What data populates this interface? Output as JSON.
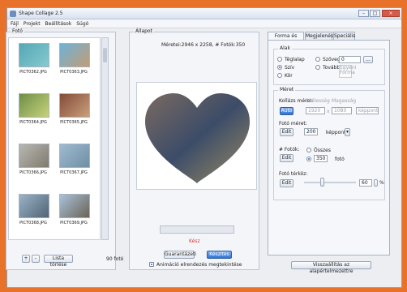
{
  "window": {
    "title": "Shape Collage 2.5"
  },
  "menu": [
    "Fájl",
    "Projekt",
    "Beállítások",
    "Súgó"
  ],
  "photo_panel": {
    "title": "Fotó",
    "thumbs": [
      {
        "label": "PICT0362.JPG"
      },
      {
        "label": "PICT0363.JPG"
      },
      {
        "label": "PICT0364.JPG"
      },
      {
        "label": "PICT0365.JPG"
      },
      {
        "label": "PICT0366.JPG"
      },
      {
        "label": "PICT0367.JPG"
      },
      {
        "label": "PICT0368.JPG"
      },
      {
        "label": "PICT0369.JPG"
      }
    ],
    "add_label": "+",
    "remove_label": "-",
    "clear_label": "Lista törlése",
    "count_label": "90 fotó"
  },
  "state_panel": {
    "title": "Állapot",
    "info": "Méretei:2946 x 2258, # Fotók:350",
    "status": "Kész",
    "save_label": "Guarantázeti",
    "create_label": "Készítés",
    "option_label": "Animáció elrendezés megtekintése"
  },
  "right_panel": {
    "tabs": [
      "Forma és Méret",
      "Megjelenés",
      "Speciális"
    ],
    "shape_group_title": "Alak",
    "shape_options": [
      {
        "label": "Téglalap"
      },
      {
        "label": "Szöveg"
      },
      {
        "label": "Szív"
      },
      {
        "label": "További"
      },
      {
        "label": "Kör"
      }
    ],
    "text_value": "0",
    "text_button": "...",
    "preview_text": "Egyéni Forma",
    "size_group_title": "Méret",
    "collage_size_label": "Kollázs méret:",
    "auto_button": "Auto",
    "width_label": "Szélesség",
    "width_value": "1920",
    "height_label": "Magasság",
    "height_value": "1080",
    "unit_value": "képpont",
    "photo_size_label": "Fotó méret:",
    "photo_size_button": "Edit",
    "photo_size_value": "200",
    "photo_size_unit": "képpont",
    "photo_count_label": "# Fotók:",
    "photo_count_button": "Edit",
    "all_label": "Összes",
    "count_value": "350",
    "count_unit": "fotó",
    "spacing_label": "Fotó térköz:",
    "spacing_button": "Edit",
    "spacing_value": "60",
    "spacing_unit": "%",
    "restore_defaults": "Visszaállítás az alapértelmezettre"
  }
}
